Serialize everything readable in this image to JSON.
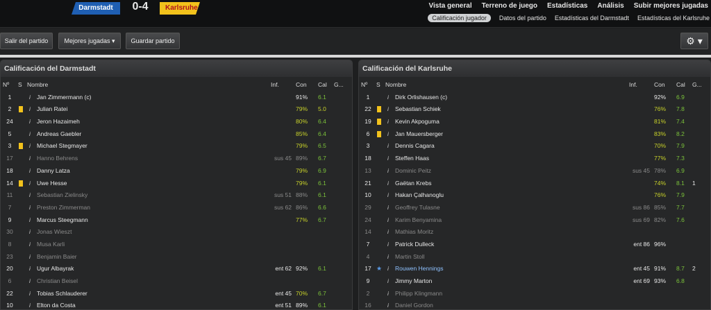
{
  "match": {
    "home": "Darmstadt",
    "away": "Karlsruhe",
    "score": "0-4",
    "home_color": "#1f5fb3",
    "away_color": "#f2c21c"
  },
  "nav_top": [
    "Vista general",
    "Terreno de juego",
    "Estadísticas",
    "Análisis",
    "Subir mejores jugadas"
  ],
  "nav_sub": [
    "Calificación jugador",
    "Datos del partido",
    "Estadísticas del Darmstadt",
    "Estadísticas del Karlsruhe"
  ],
  "toolbar": {
    "leave": "Salir del partido",
    "highlights": "Mejores jugadas",
    "save": "Guardar partido",
    "gear": "⚙ ▾"
  },
  "headers": {
    "no": "Nº",
    "s": "S",
    "name": "Nombre",
    "inf": "Inf.",
    "con": "Con",
    "cal": "Cal",
    "g": "G..."
  },
  "left": {
    "title": "Calificación del Darmstadt",
    "rows": [
      {
        "no": "1",
        "card": false,
        "name": "Jan Zimmermann (c)",
        "inf": "",
        "con": "91%",
        "cal": "6.1",
        "g": "",
        "dim": false
      },
      {
        "no": "2",
        "card": true,
        "name": "Julian Ratei",
        "inf": "",
        "con": "79%",
        "cal": "5.0",
        "g": "",
        "dim": false
      },
      {
        "no": "24",
        "card": false,
        "name": "Jeron Hazaimeh",
        "inf": "",
        "con": "80%",
        "cal": "6.4",
        "g": "",
        "dim": false
      },
      {
        "no": "5",
        "card": false,
        "name": "Andreas Gaebler",
        "inf": "",
        "con": "85%",
        "cal": "6.4",
        "g": "",
        "dim": false
      },
      {
        "no": "3",
        "card": true,
        "name": "Michael Stegmayer",
        "inf": "",
        "con": "79%",
        "cal": "6.5",
        "g": "",
        "dim": false
      },
      {
        "no": "17",
        "card": false,
        "name": "Hanno Behrens",
        "inf": "sus 45",
        "con": "89%",
        "cal": "6.7",
        "g": "",
        "dim": true
      },
      {
        "no": "18",
        "card": false,
        "name": "Danny Latza",
        "inf": "",
        "con": "79%",
        "cal": "6.9",
        "g": "",
        "dim": false
      },
      {
        "no": "14",
        "card": true,
        "name": "Uwe Hesse",
        "inf": "",
        "con": "79%",
        "cal": "6.1",
        "g": "",
        "dim": false
      },
      {
        "no": "11",
        "card": false,
        "name": "Sebastian Zielinsky",
        "inf": "sus 51",
        "con": "88%",
        "cal": "6.1",
        "g": "",
        "dim": true
      },
      {
        "no": "7",
        "card": false,
        "name": "Preston Zimmerman",
        "inf": "sus 62",
        "con": "86%",
        "cal": "6.6",
        "g": "",
        "dim": true
      },
      {
        "no": "9",
        "card": false,
        "name": "Marcus Steegmann",
        "inf": "",
        "con": "77%",
        "cal": "6.7",
        "g": "",
        "dim": false
      },
      {
        "no": "30",
        "card": false,
        "name": "Jonas Wieszt",
        "inf": "",
        "con": "",
        "cal": "",
        "g": "",
        "dim": true
      },
      {
        "no": "8",
        "card": false,
        "name": "Musa Karli",
        "inf": "",
        "con": "",
        "cal": "",
        "g": "",
        "dim": true
      },
      {
        "no": "23",
        "card": false,
        "name": "Benjamin Baier",
        "inf": "",
        "con": "",
        "cal": "",
        "g": "",
        "dim": true
      },
      {
        "no": "20",
        "card": false,
        "name": "Ugur Albayrak",
        "inf": "ent 62",
        "con": "92%",
        "cal": "6.1",
        "g": "",
        "dim": false
      },
      {
        "no": "6",
        "card": false,
        "name": "Christian Beisel",
        "inf": "",
        "con": "",
        "cal": "",
        "g": "",
        "dim": true
      },
      {
        "no": "22",
        "card": false,
        "name": "Tobias Schlauderer",
        "inf": "ent 45",
        "con": "70%",
        "cal": "6.7",
        "g": "",
        "dim": false
      },
      {
        "no": "10",
        "card": false,
        "name": "Elton da Costa",
        "inf": "ent 51",
        "con": "89%",
        "cal": "6.1",
        "g": "",
        "dim": false
      }
    ]
  },
  "right": {
    "title": "Calificación del Karlsruhe",
    "rows": [
      {
        "no": "1",
        "card": false,
        "name": "Dirk Orlishausen (c)",
        "inf": "",
        "con": "92%",
        "cal": "6.9",
        "g": "",
        "dim": false
      },
      {
        "no": "22",
        "card": true,
        "name": "Sebastian Schiek",
        "inf": "",
        "con": "76%",
        "cal": "7.8",
        "g": "",
        "dim": false
      },
      {
        "no": "19",
        "card": true,
        "name": "Kevin Akpoguma",
        "inf": "",
        "con": "81%",
        "cal": "7.4",
        "g": "",
        "dim": false
      },
      {
        "no": "6",
        "card": true,
        "name": "Jan Mauersberger",
        "inf": "",
        "con": "83%",
        "cal": "8.2",
        "g": "",
        "dim": false
      },
      {
        "no": "3",
        "card": false,
        "name": "Dennis Cagara",
        "inf": "",
        "con": "70%",
        "cal": "7.9",
        "g": "",
        "dim": false
      },
      {
        "no": "18",
        "card": false,
        "name": "Steffen Haas",
        "inf": "",
        "con": "77%",
        "cal": "7.3",
        "g": "",
        "dim": false
      },
      {
        "no": "13",
        "card": false,
        "name": "Dominic Peitz",
        "inf": "sus 45",
        "con": "78%",
        "cal": "6.9",
        "g": "",
        "dim": true
      },
      {
        "no": "21",
        "card": false,
        "name": "Gaëtan Krebs",
        "inf": "",
        "con": "74%",
        "cal": "8.1",
        "g": "1",
        "dim": false
      },
      {
        "no": "10",
        "card": false,
        "name": "Hakan Çalhanoglu",
        "inf": "",
        "con": "76%",
        "cal": "7.9",
        "g": "",
        "dim": false
      },
      {
        "no": "29",
        "card": false,
        "name": "Geoffrey Tulasne",
        "inf": "sus 86",
        "con": "85%",
        "cal": "7.7",
        "g": "",
        "dim": true
      },
      {
        "no": "24",
        "card": false,
        "name": "Karim Benyamina",
        "inf": "sus 69",
        "con": "82%",
        "cal": "7.6",
        "g": "",
        "dim": true
      },
      {
        "no": "14",
        "card": false,
        "name": "Mathias Moritz",
        "inf": "",
        "con": "",
        "cal": "",
        "g": "",
        "dim": true
      },
      {
        "no": "7",
        "card": false,
        "name": "Patrick Dulleck",
        "inf": "ent 86",
        "con": "96%",
        "cal": "",
        "g": "",
        "dim": false
      },
      {
        "no": "4",
        "card": false,
        "name": "Martin Stoll",
        "inf": "",
        "con": "",
        "cal": "",
        "g": "",
        "dim": true
      },
      {
        "no": "17",
        "card": false,
        "star": true,
        "name": "Rouwen Hennings",
        "inf": "ent 45",
        "con": "91%",
        "cal": "8.7",
        "g": "2",
        "dim": false
      },
      {
        "no": "9",
        "card": false,
        "name": "Jimmy Marton",
        "inf": "ent 69",
        "con": "93%",
        "cal": "6.8",
        "g": "",
        "dim": false
      },
      {
        "no": "2",
        "card": false,
        "name": "Philipp Klingmann",
        "inf": "",
        "con": "",
        "cal": "",
        "g": "",
        "dim": true
      },
      {
        "no": "16",
        "card": false,
        "name": "Daniel Gordon",
        "inf": "",
        "con": "",
        "cal": "",
        "g": "",
        "dim": true
      }
    ]
  }
}
